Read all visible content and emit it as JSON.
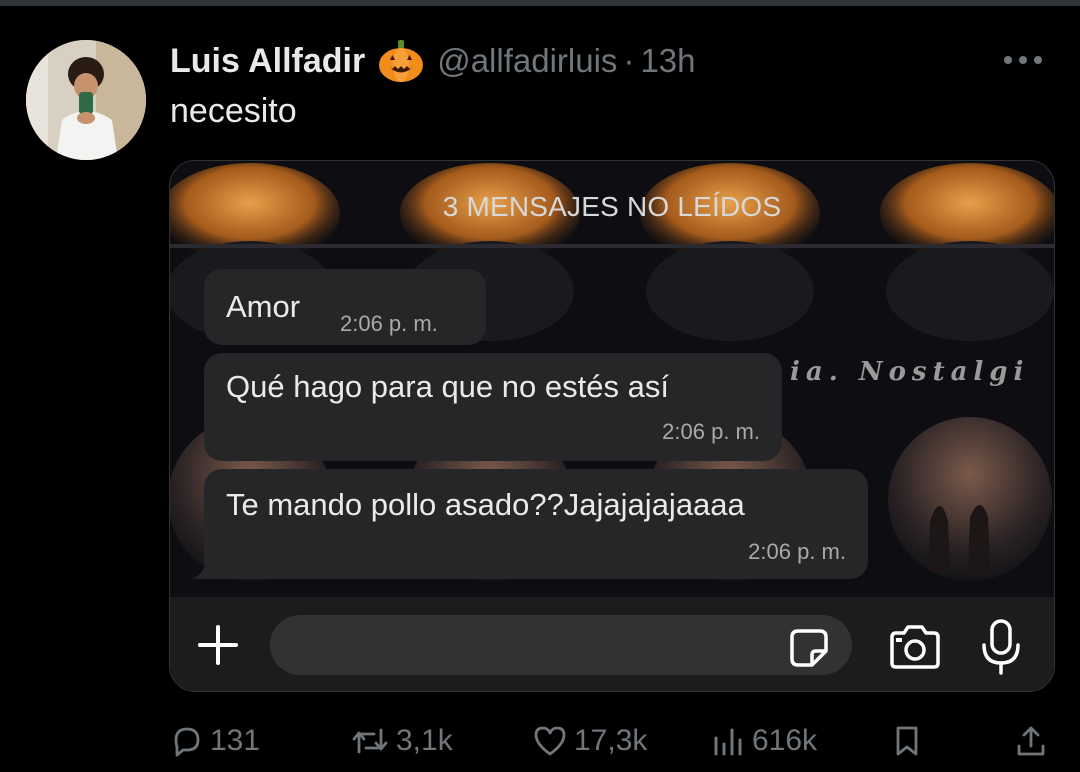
{
  "tweet": {
    "author_name": "Luis Allfadir",
    "emoji": "pumpkin-icon",
    "handle": "@allfadirluis",
    "separator": "·",
    "time": "13h",
    "text": "necesito"
  },
  "chat": {
    "unread_banner": "3 MENSAJES NO LEÍDOS",
    "background_text": "ia. Nostalgi",
    "messages": [
      {
        "text": "Amor",
        "time": "2:06 p. m."
      },
      {
        "text": "Qué hago para que no estés así",
        "time": "2:06 p. m."
      },
      {
        "text": "Te mando pollo asado??Jajajajajaaaa",
        "time": "2:06 p. m."
      }
    ],
    "input_icons": [
      "plus-icon",
      "sticker-icon",
      "camera-icon",
      "microphone-icon"
    ]
  },
  "actions": {
    "replies": "131",
    "retweets": "3,1k",
    "likes": "17,3k",
    "views": "616k"
  },
  "colors": {
    "background": "#000000",
    "text_primary": "#e7e9ea",
    "text_secondary": "#71767b",
    "bubble": "#262628",
    "pumpkin": "#f28c1b"
  }
}
